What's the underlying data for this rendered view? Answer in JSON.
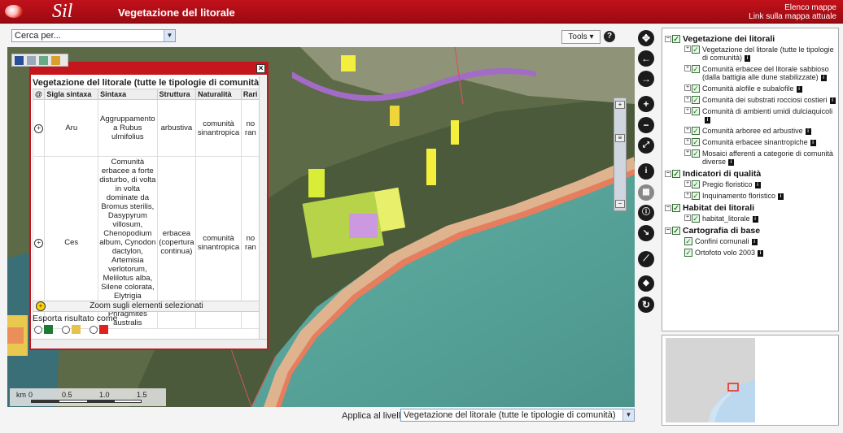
{
  "header": {
    "logo_text": "Sil",
    "title": "Vegetazione del litorale",
    "links": [
      "Elenco mappe",
      "Link sulla mappa attuale"
    ]
  },
  "toolbar": {
    "search_value": "Cerca per...",
    "tools_label": "Tools",
    "help_label": "?"
  },
  "map": {
    "scale_label": "km",
    "scale_ticks": [
      "0",
      "0.5",
      "1.0",
      "1.5"
    ]
  },
  "popup": {
    "title": "Vegetazione del litorale (tutte le tipologie di comunità)",
    "columns": [
      "@",
      "Sigla sintaxa",
      "Sintaxa",
      "Struttura",
      "Naturalità",
      "Rari"
    ],
    "rows": [
      {
        "sigla": "Aru",
        "sintaxa": "Aggruppamento a Rubus ulmifolius",
        "struttura": "arbustiva",
        "naturalita": "comunità sinantropica",
        "rari": "no ran"
      },
      {
        "sigla": "Ces",
        "sintaxa": "Comunità erbacee a forte disturbo, di volta in volta dominate da Bromus sterilis, Dasypyrum villosum, Chenopodium album, Cynodon dactylon, Artemisia verlotorum, Melilotus alba, Silene colorata, Elytrigia atherica, Phragmites australis",
        "struttura": "erbacea (copertura continua)",
        "naturalita": "comunità sinantropica",
        "rari": "no ran"
      }
    ],
    "zoom_selected": "Zoom sugli elementi selezionati",
    "export_label": "Esporta risultato come"
  },
  "bottom": {
    "apply_label": "Applica al livello",
    "apply_value": "Vegetazione del litorale (tutte le tipologie di comunità)"
  },
  "layers": {
    "groups": [
      {
        "name": "Vegetazione dei litorali",
        "items": [
          "Vegetazione del litorale (tutte le tipologie di comunità)",
          "Comunità erbacee del litorale sabbioso (dalla battigia alle dune stabilizzate)",
          "Comunità alofile e subalofile",
          "Comunità dei substrati rocciosi costieri",
          "Comunità di ambienti umidi dulciaquicoli",
          "Comunità arboree ed arbustive",
          "Comunità erbacee sinantropiche",
          "Mosaici afferenti a categorie di comunità diverse"
        ]
      },
      {
        "name": "Indicatori di qualità",
        "items": [
          "Pregio floristico",
          "Inquinamento floristico"
        ]
      },
      {
        "name": "Habitat dei litorali",
        "items": [
          "habitat_litorale"
        ]
      },
      {
        "name": "Cartografia di base",
        "items": [
          "Confini comunali",
          "Ortofoto volo 2003"
        ]
      }
    ]
  },
  "colors": {
    "brand": "#c5151d",
    "sea": "#3d7f7a"
  }
}
